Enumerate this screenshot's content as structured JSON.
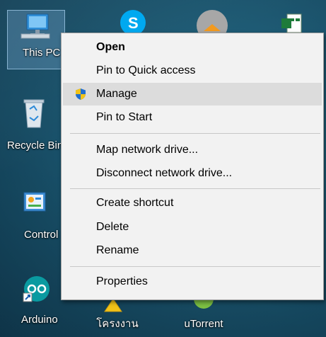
{
  "desktop": {
    "icons": [
      {
        "label": "This PC"
      },
      {
        "label": "Recycle Bin"
      },
      {
        "label": "Control Panel"
      },
      {
        "label": "Arduino"
      },
      {
        "label": "โครงงาน"
      },
      {
        "label": "uTorrent"
      }
    ]
  },
  "context_menu": {
    "items": [
      {
        "label": "Open"
      },
      {
        "label": "Pin to Quick access"
      },
      {
        "label": "Manage"
      },
      {
        "label": "Pin to Start"
      },
      {
        "label": "Map network drive..."
      },
      {
        "label": "Disconnect network drive..."
      },
      {
        "label": "Create shortcut"
      },
      {
        "label": "Delete"
      },
      {
        "label": "Rename"
      },
      {
        "label": "Properties"
      }
    ]
  },
  "colors": {
    "menu_bg": "#f2f2f2",
    "hover_bg": "#dcdcdc",
    "desktop_bg": "#1c5a74",
    "shield_blue": "#1f6fd1",
    "shield_yellow": "#f2c318"
  }
}
